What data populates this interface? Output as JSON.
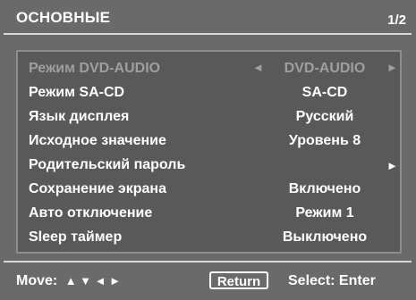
{
  "header": {
    "title": "ОСНОВНЫЕ",
    "page_indicator": "1/2"
  },
  "menu": {
    "items": [
      {
        "label": "Режим DVD-AUDIO",
        "value": "DVD-AUDIO",
        "disabled": true
      },
      {
        "label": "Режим SA-CD",
        "value": "SA-CD"
      },
      {
        "label": "Язык дисплея",
        "value": "Русский"
      },
      {
        "label": "Исходное значение",
        "value": "Уровень 8"
      },
      {
        "label": "Родительский пароль",
        "value": ""
      },
      {
        "label": "Сохранение экрана",
        "value": "Включено"
      },
      {
        "label": "Авто отключение",
        "value": "Режим 1"
      },
      {
        "label": "Sleep таймер",
        "value": "Выключено"
      }
    ]
  },
  "footer": {
    "move_label": "Move:",
    "move_glyphs": "▲ ▼ ◄ ►",
    "return_label": "Return",
    "select_label": "Select: Enter"
  },
  "colors": {
    "background": "#6a6a6a",
    "panel": "#595959",
    "text": "#ffffff",
    "disabled_text": "#9f9f9f"
  },
  "icons": {
    "left_arrow": "◄",
    "right_arrow": "►"
  }
}
